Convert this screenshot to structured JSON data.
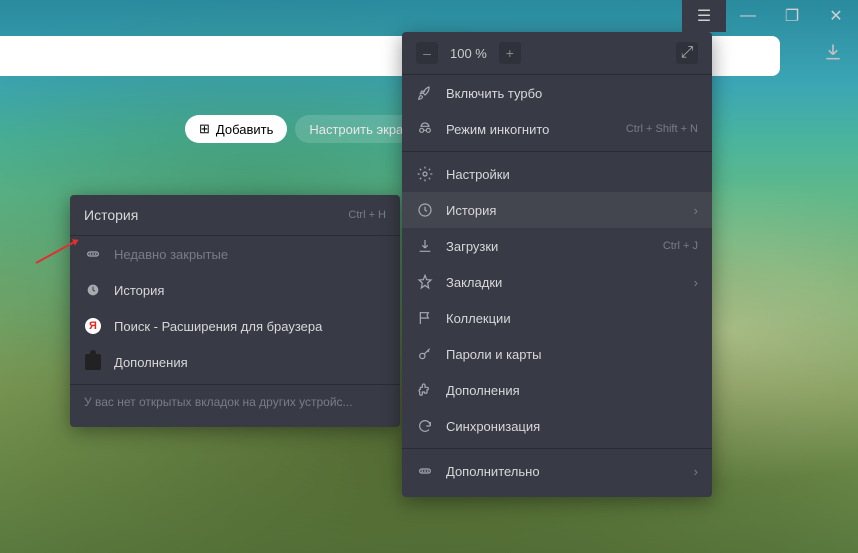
{
  "titlebar": {
    "menu": "☰",
    "min": "—",
    "max": "❐",
    "close": "✕"
  },
  "zoom": {
    "minus": "–",
    "value": "100 %",
    "plus": "+",
    "expand": "⤢"
  },
  "toolbar": {
    "add": "Добавить",
    "customize": "Настроить экра"
  },
  "menu": {
    "turbo": "Включить турбо",
    "incognito": "Режим инкогнито",
    "incognito_sc": "Ctrl + Shift + N",
    "settings": "Настройки",
    "history": "История",
    "downloads": "Загрузки",
    "downloads_sc": "Ctrl + J",
    "bookmarks": "Закладки",
    "collections": "Коллекции",
    "passwords": "Пароли и карты",
    "addons": "Дополнения",
    "sync": "Синхронизация",
    "more": "Дополнительно"
  },
  "submenu": {
    "title": "История",
    "title_sc": "Ctrl + H",
    "recent": "Недавно закрытые",
    "history": "История",
    "search": "Поиск - Расширения для браузера",
    "addons": "Дополнения",
    "footer": "У вас нет открытых вкладок на других устройс..."
  }
}
